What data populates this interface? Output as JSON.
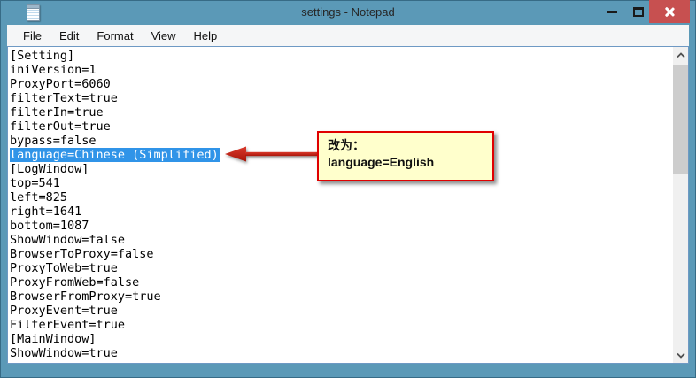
{
  "window": {
    "title": "settings - Notepad"
  },
  "menu": {
    "items": [
      {
        "label": "File",
        "pre": "",
        "key": "F",
        "post": "ile"
      },
      {
        "label": "Edit",
        "pre": "",
        "key": "E",
        "post": "dit"
      },
      {
        "label": "Format",
        "pre": "F",
        "key": "o",
        "post": "rmat"
      },
      {
        "label": "View",
        "pre": "",
        "key": "V",
        "post": "iew"
      },
      {
        "label": "Help",
        "pre": "",
        "key": "H",
        "post": "elp"
      }
    ]
  },
  "editor": {
    "selected_line_index": 7,
    "lines": [
      "[Setting]",
      "iniVersion=1",
      "ProxyPort=6060",
      "filterText=true",
      "filterIn=true",
      "filterOut=true",
      "bypass=false",
      "language=Chinese (Simplified)",
      "[LogWindow]",
      "top=541",
      "left=825",
      "right=1641",
      "bottom=1087",
      "ShowWindow=false",
      "BrowserToProxy=false",
      "ProxyToWeb=true",
      "ProxyFromWeb=false",
      "BrowserFromProxy=true",
      "ProxyEvent=true",
      "FilterEvent=true",
      "[MainWindow]",
      "ShowWindow=true"
    ]
  },
  "annotation": {
    "line1": "改为：",
    "line2": "language=English"
  },
  "colors": {
    "titlebar": "#5B99B7",
    "close_button": "#C75050",
    "selection": "#3094E8",
    "callout_background": "#FFFFCC",
    "callout_border": "#E00000",
    "arrow": "#C9241B"
  }
}
